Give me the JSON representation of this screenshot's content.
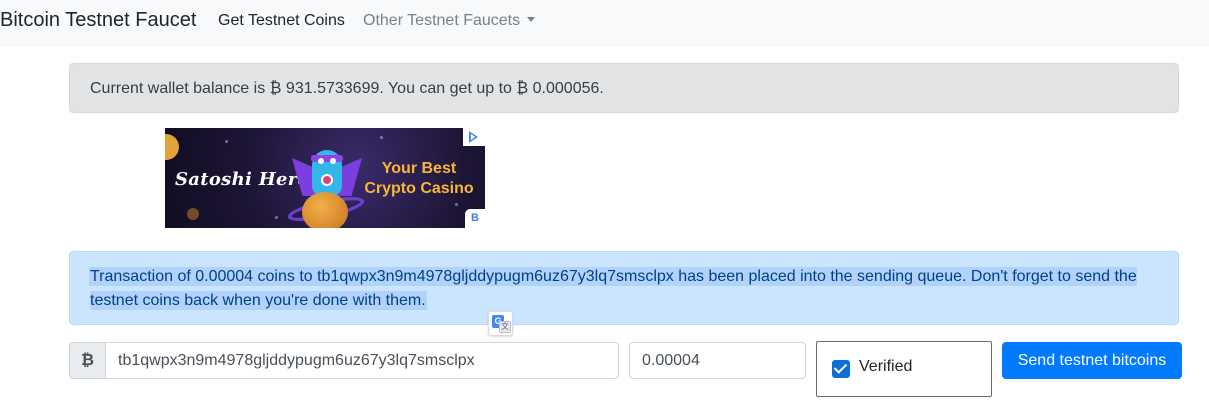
{
  "navbar": {
    "brand": "Bitcoin Testnet Faucet",
    "links": [
      {
        "label": "Get Testnet Coins",
        "active": true
      },
      {
        "label": "Other Testnet Faucets",
        "dropdown": true
      }
    ]
  },
  "balance": {
    "text": "Current wallet balance is ₿ 931.5733699. You can get up to ₿ 0.000056."
  },
  "ad": {
    "brand_text": "Satoshi Hero",
    "tagline": "Your Best Crypto Casino",
    "badge": "B",
    "choices_icon": "adchoices-icon"
  },
  "alert": {
    "text": "Transaction of 0.00004 coins to tb1qwpx3n9m4978gljddypugm6uz67y3lq7smsclpx has been placed into the sending queue. Don't forget to send the testnet coins back when you're done with them.",
    "selected": true
  },
  "form": {
    "currency_symbol": "₿",
    "address_value": "tb1qwpx3n9m4978gljddypugm6uz67y3lq7smsclpx",
    "amount_value": "0.00004",
    "captcha_label": "Verified",
    "captcha_checked": true,
    "submit_label": "Send testnet bitcoins"
  },
  "colors": {
    "primary": "#007bff",
    "alert_info_bg": "#cce5ff",
    "balance_bg": "#e2e3e5",
    "navbar_bg": "#f8f9fa"
  }
}
